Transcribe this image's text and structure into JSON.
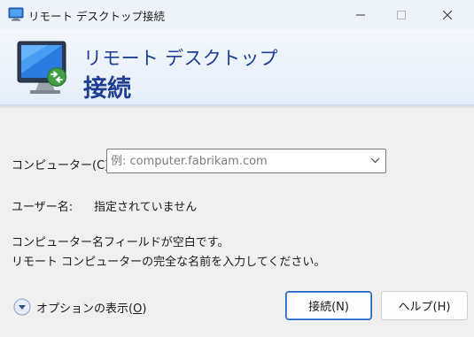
{
  "window": {
    "title": "リモート デスクトップ接続"
  },
  "header": {
    "title": "リモート デスクトップ",
    "subtitle": "接続"
  },
  "form": {
    "computer_label": "コンピューター(C):",
    "computer_placeholder": "例: computer.fabrikam.com",
    "computer_value": "",
    "user_label": "ユーザー名:",
    "user_value": "指定されていません"
  },
  "message": {
    "line1": "コンピューター名フィールドが空白です。",
    "line2": "リモート コンピューターの完全な名前を入力してください。"
  },
  "options": {
    "label_prefix": "オプションの表示(",
    "label_accel": "O",
    "label_suffix": ")"
  },
  "buttons": {
    "connect": "接続(N)",
    "help": "ヘルプ(H)"
  },
  "icons": {
    "app": "remote-desktop-icon",
    "header": "remote-desktop-monitor-icon",
    "options": "chevron-down-circle-icon",
    "dropdown": "chevron-down-icon"
  },
  "colors": {
    "header_text": "#1f3f93",
    "primary_border": "#1f5fbf"
  }
}
